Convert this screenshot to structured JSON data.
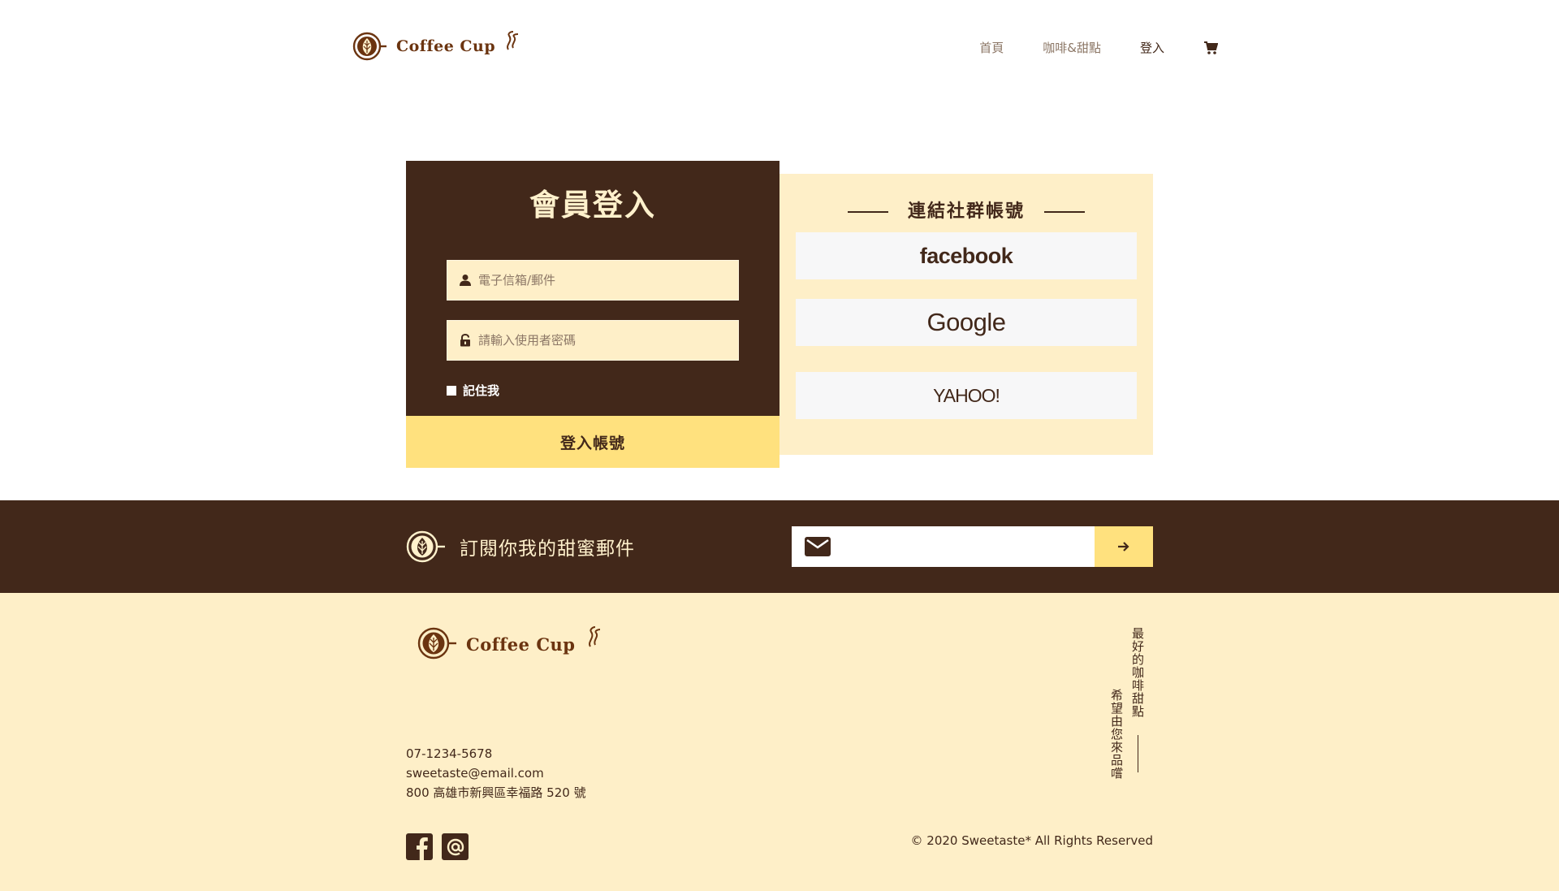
{
  "brand": {
    "name": "Coffee Cup",
    "color": "#6b3410"
  },
  "colors": {
    "dark_brown": "#42281a",
    "cream": "#feefc8",
    "yellow": "#ffe17e"
  },
  "nav": {
    "items": [
      {
        "label": "首頁"
      },
      {
        "label": "咖啡&甜點"
      },
      {
        "label": "登入"
      }
    ],
    "active": "登入",
    "cart_icon": "cart-icon"
  },
  "login": {
    "title": "會員登入",
    "email_placeholder": "電子信箱/郵件",
    "password_placeholder": "請輸入使用者密碼",
    "remember_label": "記住我",
    "submit_label": "登入帳號"
  },
  "social": {
    "title": "連結社群帳號",
    "providers": [
      {
        "label": "facebook"
      },
      {
        "label": "Google"
      },
      {
        "label": "YAHOO!"
      }
    ]
  },
  "subscribe": {
    "text": "訂閱你我的甜蜜郵件",
    "email_value": "",
    "mail_icon": "envelope-icon",
    "submit_icon": "arrow-right-icon"
  },
  "footer": {
    "phone": "07-1234-5678",
    "email": "sweetaste@email.com",
    "address": "800 高雄市新興區幸福路 520 號",
    "copyright": "© 2020 Sweetaste* All Rights Reserved",
    "slogan_line1": "最好的咖啡甜點",
    "slogan_line2": "希望由您來品嚐",
    "social_icons": [
      "facebook-icon",
      "at-sign-icon"
    ]
  }
}
